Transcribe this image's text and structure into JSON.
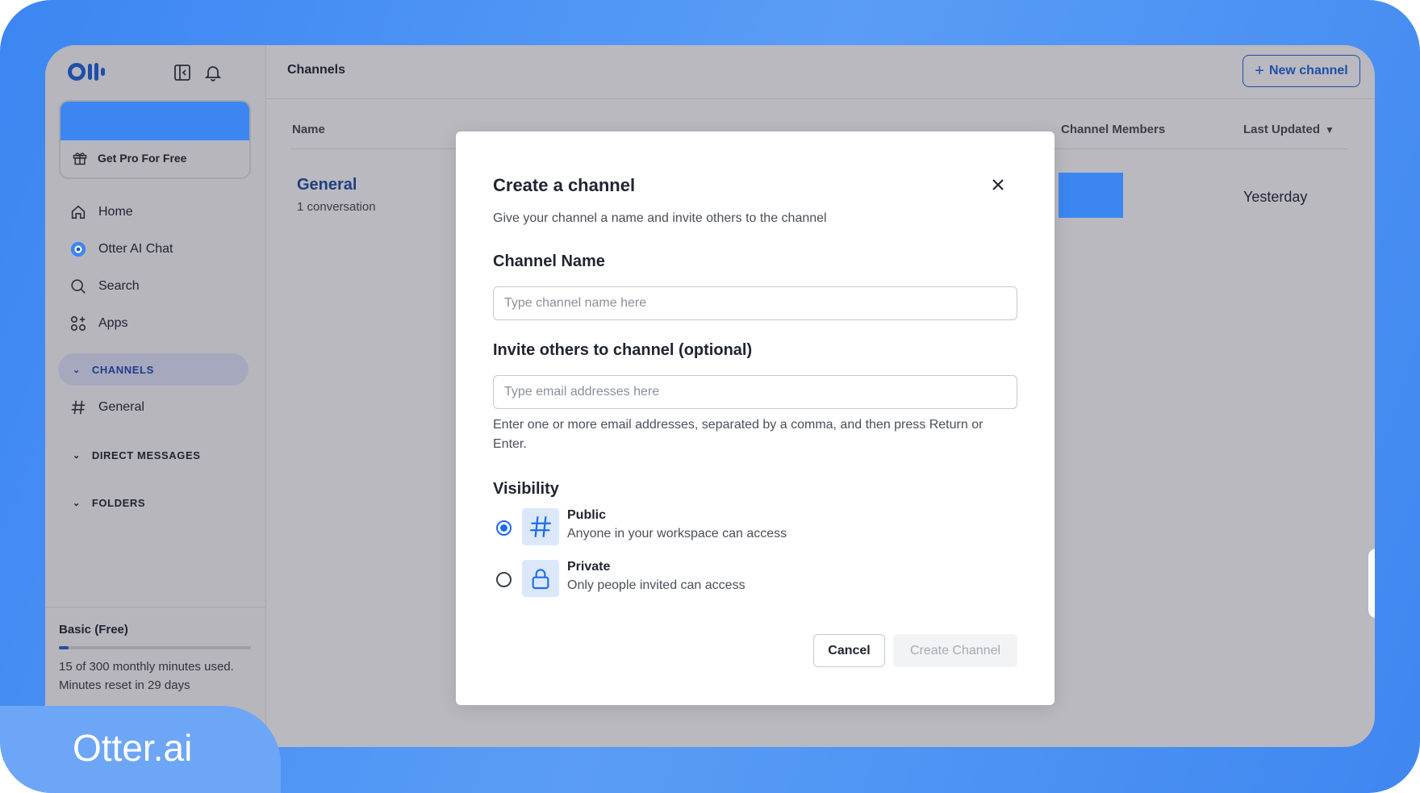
{
  "sidebar": {
    "get_pro": "Get Pro For Free",
    "nav": [
      "Home",
      "Otter AI Chat",
      "Search",
      "Apps"
    ],
    "channels_label": "CHANNELS",
    "channel_items": [
      "General"
    ],
    "direct_messages_label": "DIRECT MESSAGES",
    "folders_label": "FOLDERS",
    "plan": {
      "title": "Basic (Free)",
      "usage_text": "15 of 300 monthly minutes used. Minutes reset in 29 days",
      "progress_fraction": 0.05
    }
  },
  "header": {
    "title": "Channels",
    "new_channel": "New channel"
  },
  "table": {
    "columns": [
      "Name",
      "Channel Members",
      "Last Updated"
    ],
    "rows": [
      {
        "name": "General",
        "sub": "1 conversation",
        "updated": "Yesterday"
      }
    ]
  },
  "modal": {
    "title": "Create a channel",
    "subtitle": "Give your channel a name and invite others to the channel",
    "name_label": "Channel Name",
    "name_placeholder": "Type channel name here",
    "invite_label": "Invite others to channel (optional)",
    "invite_placeholder": "Type email addresses here",
    "invite_help": "Enter one or more email addresses, separated by a comma, and then press Return or Enter.",
    "visibility_label": "Visibility",
    "options": [
      {
        "title": "Public",
        "desc": "Anyone in your workspace can access",
        "selected": true
      },
      {
        "title": "Private",
        "desc": "Only people invited can access",
        "selected": false
      }
    ],
    "cancel": "Cancel",
    "create": "Create Channel"
  },
  "brand": "Otter.ai",
  "colors": {
    "accent": "#1e6ce8",
    "brand_blue": "#3c86f2",
    "navy": "#1e4fa8"
  }
}
